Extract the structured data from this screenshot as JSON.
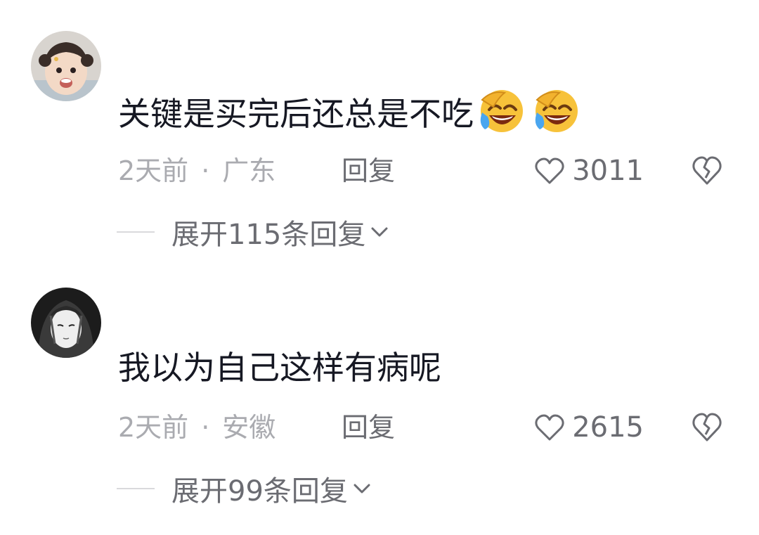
{
  "comments": [
    {
      "avatar_icon": "avatar-child-photo",
      "text": "关键是买完后还总是不吃",
      "emojis": [
        "laughing-tears-emoji",
        "laughing-tears-emoji"
      ],
      "time": "2天前",
      "separator": "·",
      "location": "广东",
      "reply_label": "回复",
      "like_count": "3011",
      "expand_label": "展开115条回复"
    },
    {
      "avatar_icon": "avatar-anime-girl-sketch",
      "text": "我以为自己这样有病呢",
      "emojis": [],
      "time": "2天前",
      "separator": "·",
      "location": "安徽",
      "reply_label": "回复",
      "like_count": "2615",
      "expand_label": "展开99条回复"
    }
  ],
  "colors": {
    "text": "#161823",
    "meta": "#aaabb0",
    "secondary": "#6b6c72",
    "divider": "#d9d9dc"
  }
}
